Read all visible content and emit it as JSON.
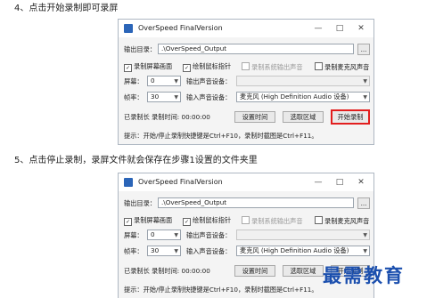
{
  "steps": [
    {
      "text": "4、点击开始录制即可录屏"
    },
    {
      "text": "5、点击停止录制，录屏文件就会保存在步骤1设置的文件夹里"
    }
  ],
  "window": {
    "title": "OverSpeed FinalVersion",
    "output_label": "输出目录：",
    "output_value": ".\\OverSpeed_Output",
    "browse_label": "...",
    "check_record_screen": "录制屏幕画面",
    "check_draw_cursor": "绘制鼠标指针",
    "check_record_system": "录制系统输出声音",
    "check_record_mic": "录制麦克风声音",
    "screen_label": "屏幕：",
    "screen_value": "0",
    "output_audio_label": "输出声音设备：",
    "fps_label": "帧率：",
    "fps_value": "30",
    "input_audio_label": "输入声音设备：",
    "input_audio_value": "麦克风 (High Definition Audio 设备)",
    "status_label": "已录制长 录制时间: 00:00:00",
    "set_time_label": "设置时间",
    "select_region_label": "选取区域",
    "start_label": "开始录制",
    "hint": "提示：开始/停止录制快捷键是Ctrl+F10，录制时截图是Ctrl+F11。"
  },
  "watermark": "最需教育"
}
